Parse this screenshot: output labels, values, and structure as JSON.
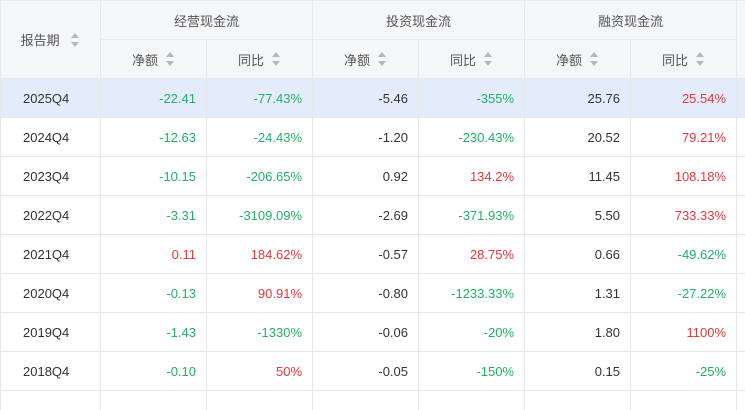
{
  "header": {
    "period_label": "报告期",
    "groups": [
      {
        "label": "经营现金流"
      },
      {
        "label": "投资现金流"
      },
      {
        "label": "融资现金流"
      }
    ],
    "sub_columns": [
      "净额",
      "同比",
      "净额",
      "同比",
      "净额",
      "同比"
    ]
  },
  "rows": [
    {
      "period": "2025Q4",
      "selected": true,
      "cells": [
        {
          "text": "-22.41",
          "tone": "green"
        },
        {
          "text": "-77.43%",
          "tone": "green"
        },
        {
          "text": "-5.46",
          "tone": "plain"
        },
        {
          "text": "-355%",
          "tone": "green"
        },
        {
          "text": "25.76",
          "tone": "plain"
        },
        {
          "text": "25.54%",
          "tone": "red"
        }
      ]
    },
    {
      "period": "2024Q4",
      "cells": [
        {
          "text": "-12.63",
          "tone": "green"
        },
        {
          "text": "-24.43%",
          "tone": "green"
        },
        {
          "text": "-1.20",
          "tone": "plain"
        },
        {
          "text": "-230.43%",
          "tone": "green"
        },
        {
          "text": "20.52",
          "tone": "plain"
        },
        {
          "text": "79.21%",
          "tone": "red"
        }
      ]
    },
    {
      "period": "2023Q4",
      "cells": [
        {
          "text": "-10.15",
          "tone": "green"
        },
        {
          "text": "-206.65%",
          "tone": "green"
        },
        {
          "text": "0.92",
          "tone": "plain"
        },
        {
          "text": "134.2%",
          "tone": "red"
        },
        {
          "text": "11.45",
          "tone": "plain"
        },
        {
          "text": "108.18%",
          "tone": "red"
        }
      ]
    },
    {
      "period": "2022Q4",
      "cells": [
        {
          "text": "-3.31",
          "tone": "green"
        },
        {
          "text": "-3109.09%",
          "tone": "green"
        },
        {
          "text": "-2.69",
          "tone": "plain"
        },
        {
          "text": "-371.93%",
          "tone": "green"
        },
        {
          "text": "5.50",
          "tone": "plain"
        },
        {
          "text": "733.33%",
          "tone": "red"
        }
      ]
    },
    {
      "period": "2021Q4",
      "cells": [
        {
          "text": "0.11",
          "tone": "red"
        },
        {
          "text": "184.62%",
          "tone": "red"
        },
        {
          "text": "-0.57",
          "tone": "plain"
        },
        {
          "text": "28.75%",
          "tone": "red"
        },
        {
          "text": "0.66",
          "tone": "plain"
        },
        {
          "text": "-49.62%",
          "tone": "green"
        }
      ]
    },
    {
      "period": "2020Q4",
      "cells": [
        {
          "text": "-0.13",
          "tone": "green"
        },
        {
          "text": "90.91%",
          "tone": "red"
        },
        {
          "text": "-0.80",
          "tone": "plain"
        },
        {
          "text": "-1233.33%",
          "tone": "green"
        },
        {
          "text": "1.31",
          "tone": "plain"
        },
        {
          "text": "-27.22%",
          "tone": "green"
        }
      ]
    },
    {
      "period": "2019Q4",
      "cells": [
        {
          "text": "-1.43",
          "tone": "green"
        },
        {
          "text": "-1330%",
          "tone": "green"
        },
        {
          "text": "-0.06",
          "tone": "plain"
        },
        {
          "text": "-20%",
          "tone": "green"
        },
        {
          "text": "1.80",
          "tone": "plain"
        },
        {
          "text": "1100%",
          "tone": "red"
        }
      ]
    },
    {
      "period": "2018Q4",
      "cells": [
        {
          "text": "-0.10",
          "tone": "green"
        },
        {
          "text": "50%",
          "tone": "red"
        },
        {
          "text": "-0.05",
          "tone": "plain"
        },
        {
          "text": "-150%",
          "tone": "green"
        },
        {
          "text": "0.15",
          "tone": "plain"
        },
        {
          "text": "-25%",
          "tone": "green"
        }
      ]
    },
    {
      "period": "",
      "cells": [
        {
          "text": "",
          "tone": "plain"
        },
        {
          "text": "",
          "tone": "plain"
        },
        {
          "text": "",
          "tone": "plain"
        },
        {
          "text": "",
          "tone": "plain"
        },
        {
          "text": "",
          "tone": "plain"
        },
        {
          "text": "",
          "tone": "plain"
        }
      ]
    }
  ],
  "colors": {
    "positive": "#e5383b",
    "negative": "#21b066",
    "selected_row": "#e4ecfc",
    "header_bg": "#f5f6f8"
  },
  "icons": {
    "sort": "sort-icon"
  }
}
